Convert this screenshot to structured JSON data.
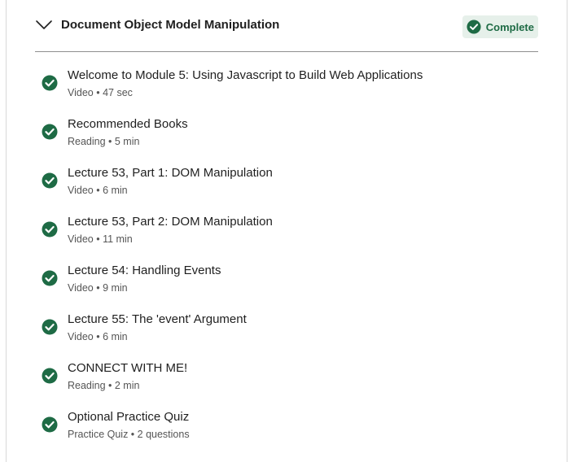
{
  "module": {
    "title": "Document Object Model Manipulation",
    "status_label": "Complete",
    "expanded": true
  },
  "colors": {
    "complete_green": "#1e6b45",
    "badge_bg": "#e6f0ea",
    "text": "#1f1f1f",
    "meta_text": "#555555",
    "divider": "#8f8f8f"
  },
  "icons": {
    "toggle": "chevron-down-icon",
    "status": "check-circle-icon"
  },
  "items": [
    {
      "title": "Welcome to Module 5: Using Javascript to Build Web Applications",
      "meta": "Video • 47 sec",
      "completed": true
    },
    {
      "title": "Recommended Books",
      "meta": "Reading • 5 min",
      "completed": true
    },
    {
      "title": "Lecture 53, Part 1: DOM Manipulation",
      "meta": "Video • 6 min",
      "completed": true
    },
    {
      "title": "Lecture 53, Part 2: DOM Manipulation",
      "meta": "Video • 11 min",
      "completed": true
    },
    {
      "title": "Lecture 54: Handling Events",
      "meta": "Video • 9 min",
      "completed": true
    },
    {
      "title": "Lecture 55: The 'event' Argument",
      "meta": "Video • 6 min",
      "completed": true
    },
    {
      "title": "CONNECT WITH ME!",
      "meta": "Reading • 2 min",
      "completed": true
    },
    {
      "title": "Optional Practice Quiz",
      "meta": "Practice Quiz • 2 questions",
      "completed": true
    }
  ]
}
